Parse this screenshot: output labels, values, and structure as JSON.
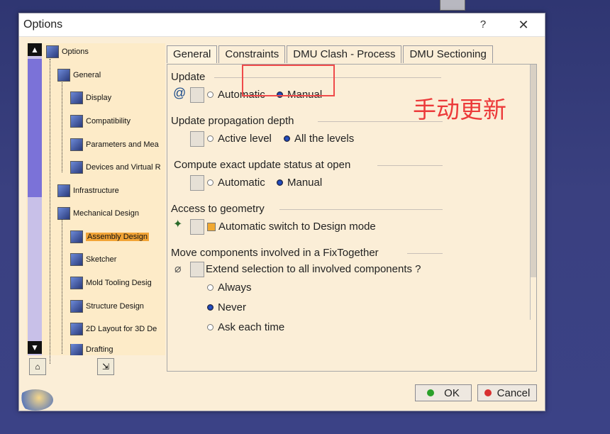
{
  "window": {
    "title": "Options",
    "help_label": "?",
    "close_label": "✕"
  },
  "tree": {
    "items": [
      {
        "label": "Options"
      },
      {
        "label": "General"
      },
      {
        "label": "Display"
      },
      {
        "label": "Compatibility"
      },
      {
        "label": "Parameters and Mea"
      },
      {
        "label": "Devices and Virtual R"
      },
      {
        "label": "Infrastructure"
      },
      {
        "label": "Mechanical Design"
      },
      {
        "label": "Assembly Design"
      },
      {
        "label": "Sketcher"
      },
      {
        "label": "Mold Tooling Desig"
      },
      {
        "label": "Structure Design"
      },
      {
        "label": "2D Layout for 3D De"
      },
      {
        "label": "Drafting"
      }
    ],
    "selected": "Assembly Design"
  },
  "tabs": [
    "General",
    "Constraints",
    "DMU Clash - Process",
    "DMU Sectioning"
  ],
  "sections": {
    "update": {
      "title": "Update",
      "options": [
        "Automatic",
        "Manual"
      ],
      "selected": "Manual"
    },
    "propagation": {
      "title": "Update propagation depth",
      "options": [
        "Active level",
        "All the levels"
      ],
      "selected": "All the levels"
    },
    "exact_status": {
      "title": "Compute exact update status at open",
      "options": [
        "Automatic",
        "Manual"
      ],
      "selected": "Manual"
    },
    "geometry": {
      "title": "Access to geometry",
      "checkbox_label": "Automatic switch to Design mode"
    },
    "fixtogether": {
      "title": "Move components involved in a FixTogether",
      "question": "Extend selection to all involved components ?",
      "options": [
        "Always",
        "Never",
        "Ask each time"
      ],
      "selected": "Never"
    }
  },
  "annotation": {
    "text": "手动更新",
    "color": "#ec3a3a"
  },
  "buttons": {
    "ok": "OK",
    "cancel": "Cancel"
  },
  "colors": {
    "ok_dot": "#2aa02a",
    "cancel_dot": "#d83030",
    "selection": "#f2a436"
  }
}
